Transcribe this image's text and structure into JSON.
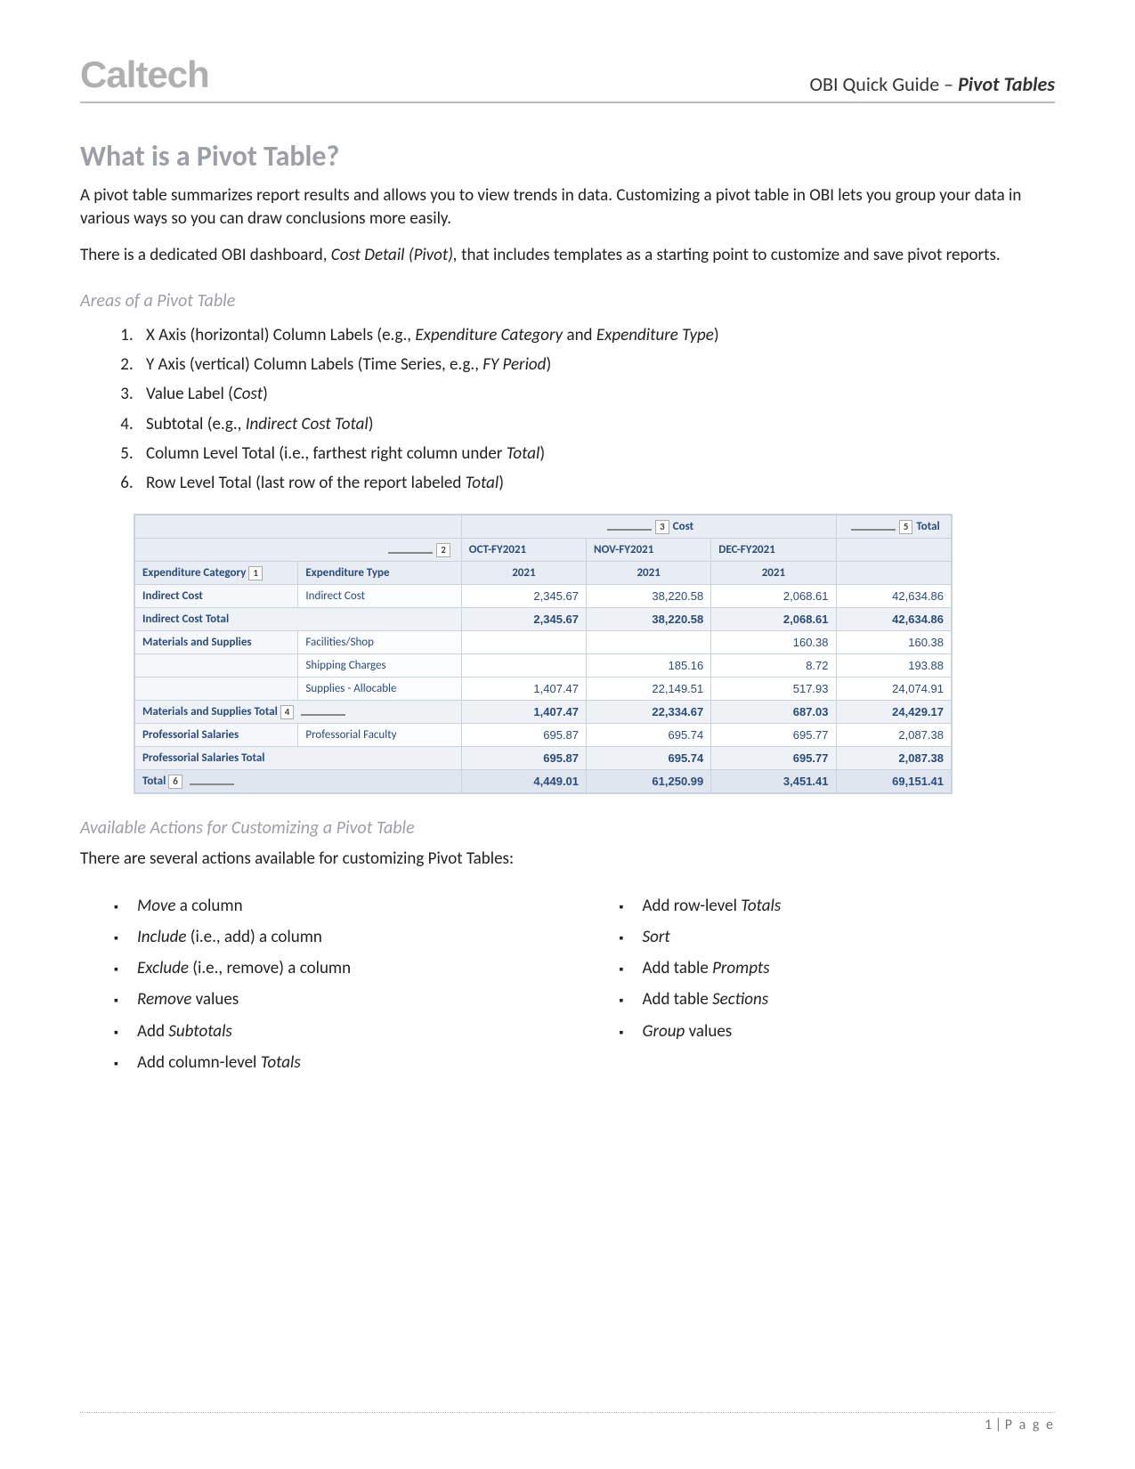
{
  "header": {
    "logo": "Caltech",
    "doc_title_prefix": "OBI Quick Guide – ",
    "doc_title_subject": "Pivot Tables"
  },
  "section": {
    "title": "What is a Pivot Table?",
    "para1": "A pivot table summarizes report results and allows you to view trends in data. Customizing a pivot table in OBI lets you group your data in various ways so you can draw conclusions more easily.",
    "para2_a": "There is a dedicated OBI dashboard, ",
    "para2_i": "Cost Detail (Pivot),",
    "para2_b": " that includes templates as a starting point to customize and save pivot reports."
  },
  "areas": {
    "heading": "Areas of a Pivot Table",
    "items": [
      {
        "pre": "X Axis (horizontal) Column Labels (e.g., ",
        "i": "Expenditure Category",
        "mid": " and ",
        "i2": "Expenditure Type",
        "post": ")"
      },
      {
        "pre": "Y Axis (vertical) Column Labels (Time Series, e.g., ",
        "i": "FY Period",
        "post": ")"
      },
      {
        "pre": "Value Label (",
        "i": "Cost",
        "post": ")"
      },
      {
        "pre": "Subtotal (e.g., ",
        "i": "Indirect Cost Total",
        "post": ")"
      },
      {
        "pre": "Column Level Total (i.e., farthest right column under ",
        "i": "Total",
        "post": ")"
      },
      {
        "pre": "Row Level Total (last row of the report labeled ",
        "i": "Total",
        "post": ")"
      }
    ]
  },
  "pivot": {
    "callouts": {
      "c1": "1",
      "c2": "2",
      "c3": "3",
      "c4": "4",
      "c5": "5",
      "c6": "6"
    },
    "top": {
      "cost": "Cost",
      "total": "Total"
    },
    "periods": [
      "OCT-FY2021",
      "NOV-FY2021",
      "DEC-FY2021"
    ],
    "period_year": "2021",
    "colheads": {
      "cat": "Expenditure Category",
      "type": "Expenditure Type"
    },
    "rows": [
      {
        "cat": "Indirect Cost",
        "type": "Indirect Cost",
        "v": [
          "2,345.67",
          "38,220.58",
          "2,068.61",
          "42,634.86"
        ]
      },
      {
        "subtotal": "Indirect Cost Total",
        "v": [
          "2,345.67",
          "38,220.58",
          "2,068.61",
          "42,634.86"
        ]
      },
      {
        "cat": "Materials and Supplies",
        "type": "Facilities/Shop",
        "v": [
          "",
          "",
          "160.38",
          "160.38"
        ]
      },
      {
        "cat": "",
        "type": "Shipping Charges",
        "v": [
          "",
          "185.16",
          "8.72",
          "193.88"
        ]
      },
      {
        "cat": "",
        "type": "Supplies - Allocable",
        "v": [
          "1,407.47",
          "22,149.51",
          "517.93",
          "24,074.91"
        ]
      },
      {
        "subtotal": "Materials and Supplies Total",
        "v": [
          "1,407.47",
          "22,334.67",
          "687.03",
          "24,429.17"
        ]
      },
      {
        "cat": "Professorial Salaries",
        "type": "Professorial Faculty",
        "v": [
          "695.87",
          "695.74",
          "695.77",
          "2,087.38"
        ]
      },
      {
        "subtotal": "Professorial Salaries Total",
        "v": [
          "695.87",
          "695.74",
          "695.77",
          "2,087.38"
        ]
      },
      {
        "grand": "Total",
        "v": [
          "4,449.01",
          "61,250.99",
          "3,451.41",
          "69,151.41"
        ]
      }
    ]
  },
  "actions": {
    "heading": "Available Actions for Customizing a Pivot Table",
    "intro": "There are several actions available for customizing Pivot Tables:",
    "left": [
      {
        "i": "Move",
        "post": " a column"
      },
      {
        "i": "Include",
        "post": " (i.e., add) a column"
      },
      {
        "i": "Exclude",
        "post": " (i.e., remove) a column"
      },
      {
        "i": "Remove",
        "post": " values"
      },
      {
        "pre": "Add ",
        "i": "Subtotals"
      },
      {
        "pre": "Add column-level ",
        "i": "Totals"
      }
    ],
    "right": [
      {
        "pre": "Add row-level ",
        "i": "Totals"
      },
      {
        "i": "Sort"
      },
      {
        "pre": "Add table ",
        "i": "Prompts"
      },
      {
        "pre": "Add table ",
        "i": "Sections"
      },
      {
        "i": "Group",
        "post": " values"
      }
    ]
  },
  "footer": {
    "page_num": "1",
    "page_label": "P a g e"
  }
}
